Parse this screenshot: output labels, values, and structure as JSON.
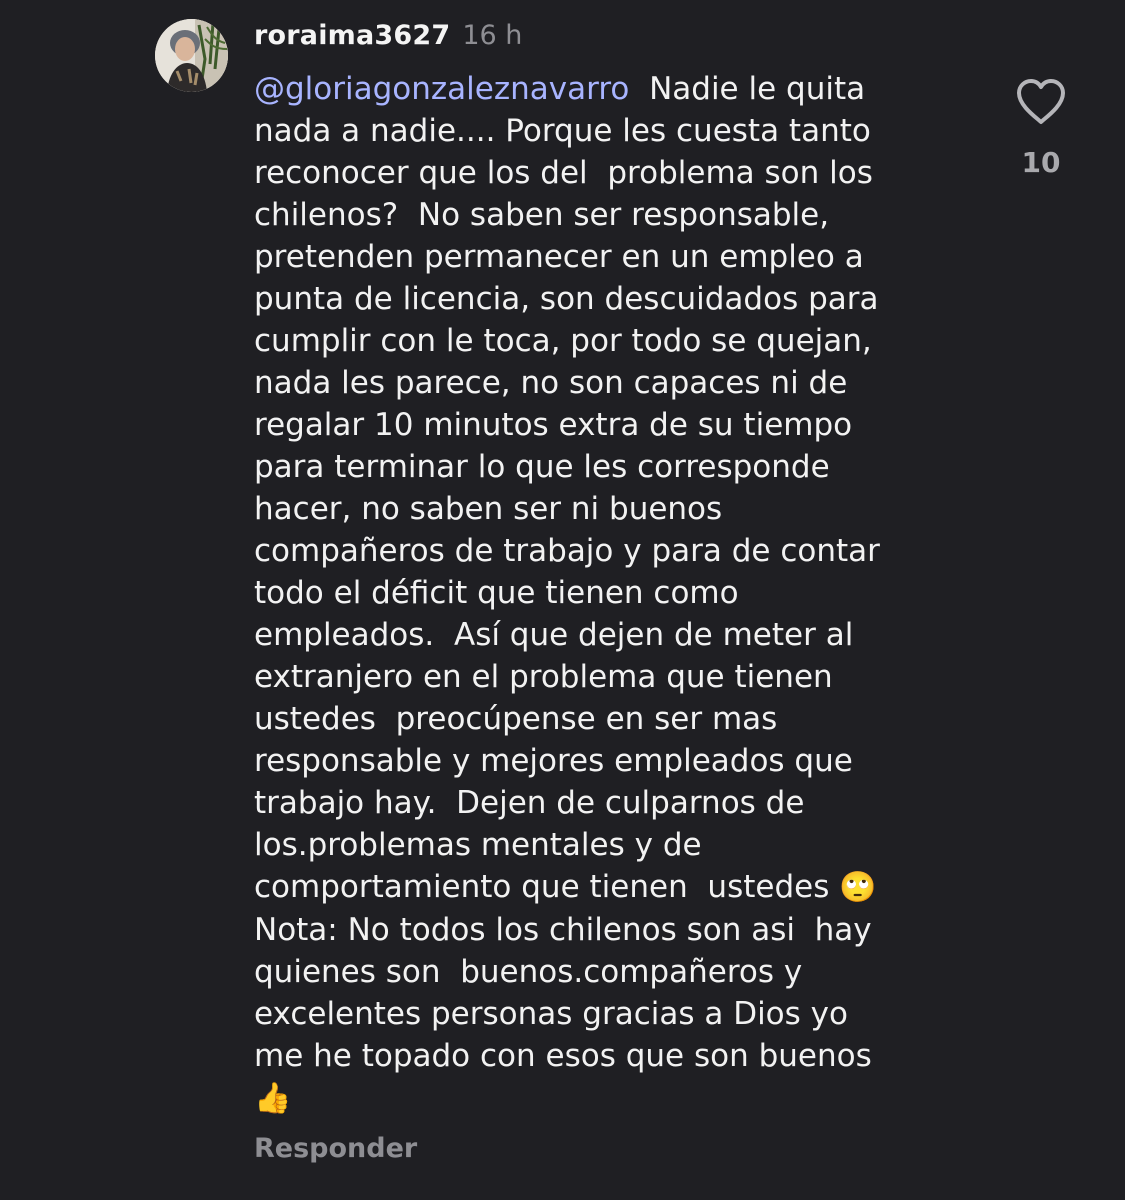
{
  "comment": {
    "username": "roraima3627",
    "time": "16 h",
    "mention": "@gloriagonzaleznavarro",
    "lines": [
      "Nadie le quita",
      "nada a nadie.... Porque les cuesta tanto",
      "reconocer que los del  problema son los",
      "chilenos?  No saben ser responsable,",
      "pretenden permanecer en un empleo a",
      "punta de licencia, son descuidados para",
      "cumplir con le toca, por todo se quejan,",
      "nada les parece, no son capaces ni de",
      "regalar 10 minutos extra de su tiempo",
      "para terminar lo que les corresponde",
      "hacer, no saben ser ni buenos",
      "compañeros de trabajo y para de contar",
      "todo el déficit que tienen como",
      "empleados.  Así que dejen de meter al",
      "extranjero en el problema que tienen",
      "ustedes  preocúpense en ser mas",
      "responsable y mejores empleados que",
      "trabajo hay.  Dejen de culparnos de",
      "los.problemas mentales y de",
      "comportamiento que tienen  ustedes ",
      "Nota: No todos los chilenos son asi  hay",
      "quienes son  buenos.compañeros y",
      "excelentes personas gracias a Dios yo",
      "me he topado con esos que son buenos",
      ""
    ],
    "emoji_eye_roll": "🙄",
    "emoji_thumbs_up": "👍",
    "reply_label": "Responder",
    "like_count": "10",
    "icons": {
      "like": "heart-outline-icon",
      "avatar": "profile-photo"
    }
  },
  "colors": {
    "background": "#1f1f23",
    "text": "#f2f2f2",
    "mention": "#a8b4ff",
    "muted": "#8e8e93"
  }
}
